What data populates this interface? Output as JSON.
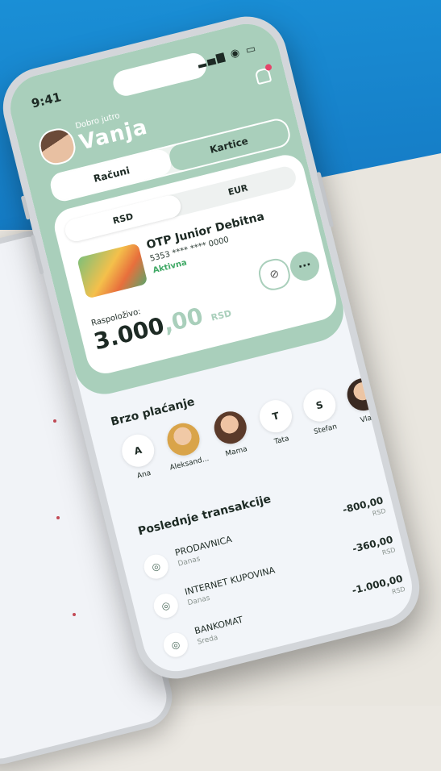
{
  "status": {
    "time": "9:41",
    "signal": "▂▄▆",
    "wifi": "◉",
    "battery": "▭"
  },
  "header": {
    "greeting": "Dobro jutro",
    "name": "Vanja"
  },
  "tabs": {
    "left": "Računi",
    "right": "Kartice"
  },
  "card": {
    "currency_left": "RSD",
    "currency_right": "EUR",
    "name": "OTP Junior Debitna",
    "number": "5353 **** **** 0000",
    "status": "Aktivna",
    "available_label": "Raspoloživo:",
    "amount_int": "3.000",
    "amount_dec": ",00",
    "amount_currency": "RSD",
    "more_label": "···",
    "eye_label": "⊘"
  },
  "quick_pay": {
    "title": "Brzo plaćanje",
    "contacts": [
      {
        "initial": "A",
        "name": "Ana"
      },
      {
        "initial": "",
        "name": "Aleksand..."
      },
      {
        "initial": "",
        "name": "Mama"
      },
      {
        "initial": "T",
        "name": "Tata"
      },
      {
        "initial": "S",
        "name": "Stefan"
      },
      {
        "initial": "",
        "name": "Vladi"
      }
    ]
  },
  "transactions": {
    "title": "Poslednje transakcije",
    "items": [
      {
        "name": "PRODAVNICA",
        "date": "Danas",
        "amount": "-800,00",
        "currency": "RSD"
      },
      {
        "name": "INTERNET KUPOVINA",
        "date": "Danas",
        "amount": "-360,00",
        "currency": "RSD"
      },
      {
        "name": "BANKOMAT",
        "date": "Sreda",
        "amount": "-1.000,00",
        "currency": "RSD"
      }
    ]
  },
  "colors": {
    "mint": "#a9cfbb",
    "blue": "#1a8fd6",
    "green_text": "#3ea864"
  }
}
